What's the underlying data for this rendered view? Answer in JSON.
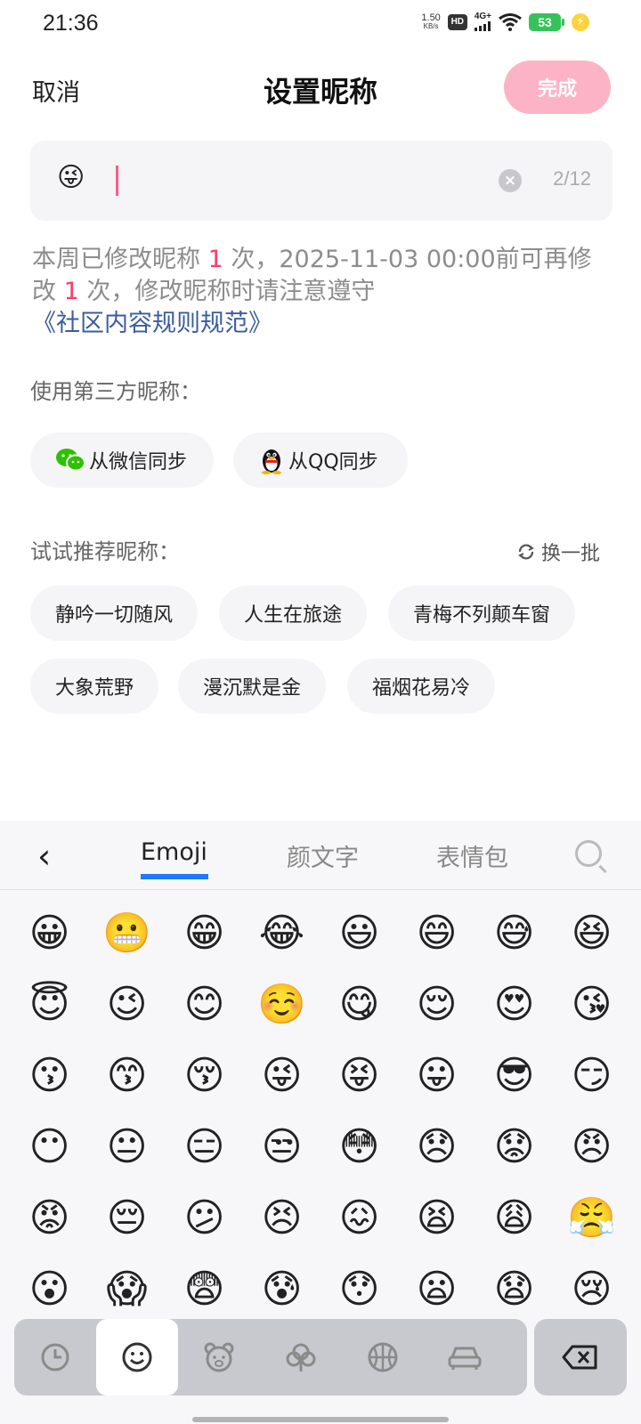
{
  "status_bar": {
    "time": "21:36",
    "speed": "1.50",
    "speed_unit": "KB/s",
    "hd": "HD",
    "network": "4G+",
    "battery": "53"
  },
  "header": {
    "cancel": "取消",
    "title": "设置昵称",
    "done": "完成"
  },
  "input": {
    "value": "😜",
    "counter": "2/12"
  },
  "notice": {
    "p1": "本周已修改昵称 ",
    "count1": "1",
    "p2": " 次，2025-11-03 00:00前可再修改 ",
    "count2": "1",
    "p3": " 次，修改昵称时请注意遵守",
    "link": "《社区内容规则规范》"
  },
  "third_party": {
    "label": "使用第三方昵称：",
    "wechat": "从微信同步",
    "qq": "从QQ同步"
  },
  "recommend": {
    "label": "试试推荐昵称：",
    "refresh": "换一批",
    "items": [
      "静吟一切随风",
      "人生在旅途",
      "青梅不列颠车窗",
      "大象荒野",
      "漫沉默是金",
      "福烟花易冷"
    ]
  },
  "keyboard": {
    "tabs": [
      "Emoji",
      "颜文字",
      "表情包"
    ],
    "active_tab": "Emoji",
    "emojis": [
      "😀",
      "😬",
      "😁",
      "😂",
      "😃",
      "😄",
      "😅",
      "😆",
      "😇",
      "😉",
      "😊",
      "☺️",
      "😋",
      "😌",
      "😍",
      "😘",
      "😗",
      "😙",
      "😚",
      "😜",
      "😝",
      "😛",
      "😎",
      "😏",
      "😶",
      "😐",
      "😑",
      "😒",
      "😳",
      "😞",
      "😟",
      "😠",
      "😡",
      "😔",
      "😕",
      "😣",
      "😖",
      "😫",
      "😩",
      "😤",
      "😮",
      "😱",
      "😨",
      "😰",
      "😯",
      "😦",
      "😧",
      "😢"
    ]
  },
  "colors": {
    "accent": "#ff3b6b",
    "done_button": "#fdb3c6",
    "link": "#3a5d9c",
    "tab_underline": "#1e7bf5"
  }
}
